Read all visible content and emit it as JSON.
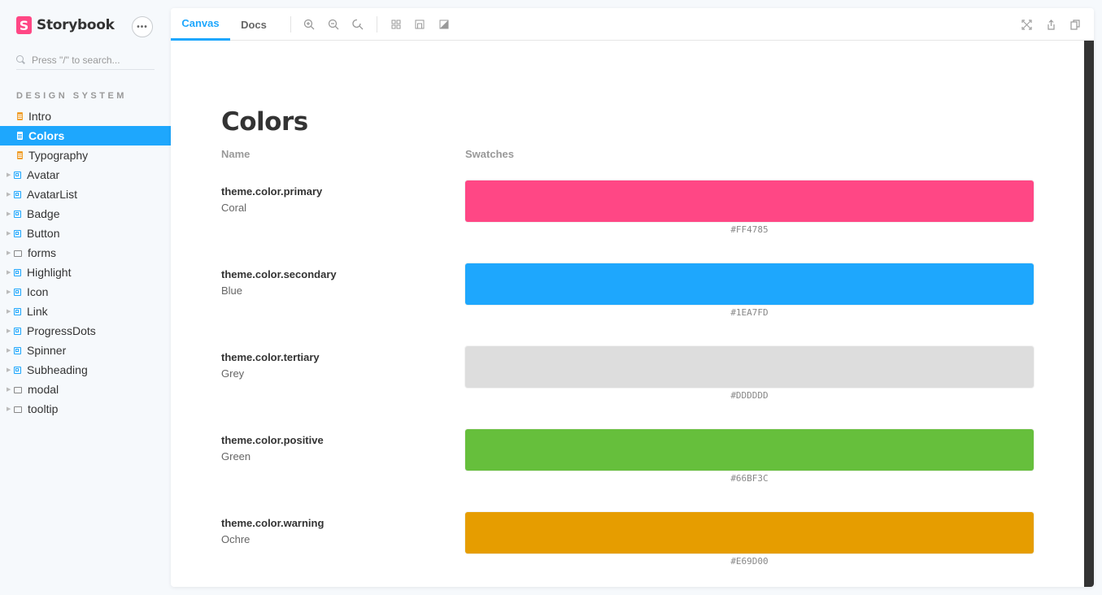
{
  "app": {
    "name": "Storybook",
    "logo_letter": "S"
  },
  "sidebar": {
    "menu_label": "•••",
    "search_placeholder": "Press \"/\" to search...",
    "section_title": "DESIGN SYSTEM",
    "items": [
      {
        "label": "Intro",
        "type": "doc",
        "expandable": false
      },
      {
        "label": "Colors",
        "type": "doc",
        "expandable": false,
        "active": true
      },
      {
        "label": "Typography",
        "type": "doc",
        "expandable": false
      },
      {
        "label": "Avatar",
        "type": "component",
        "expandable": true
      },
      {
        "label": "AvatarList",
        "type": "component",
        "expandable": true
      },
      {
        "label": "Badge",
        "type": "component",
        "expandable": true
      },
      {
        "label": "Button",
        "type": "component",
        "expandable": true
      },
      {
        "label": "forms",
        "type": "folder",
        "expandable": true
      },
      {
        "label": "Highlight",
        "type": "component",
        "expandable": true
      },
      {
        "label": "Icon",
        "type": "component",
        "expandable": true
      },
      {
        "label": "Link",
        "type": "component",
        "expandable": true
      },
      {
        "label": "ProgressDots",
        "type": "component",
        "expandable": true
      },
      {
        "label": "Spinner",
        "type": "component",
        "expandable": true
      },
      {
        "label": "Subheading",
        "type": "component",
        "expandable": true
      },
      {
        "label": "modal",
        "type": "folder",
        "expandable": true
      },
      {
        "label": "tooltip",
        "type": "folder",
        "expandable": true
      }
    ]
  },
  "toolbar": {
    "tabs": [
      {
        "label": "Canvas",
        "active": true
      },
      {
        "label": "Docs",
        "active": false
      }
    ],
    "tools": [
      "zoom-in-icon",
      "zoom-out-icon",
      "zoom-reset-icon",
      "grid-icon",
      "outline-icon",
      "contrast-icon"
    ],
    "right_tools": [
      "fullscreen-icon",
      "share-icon",
      "copy-link-icon"
    ]
  },
  "page": {
    "title": "Colors",
    "col_name": "Name",
    "col_swatches": "Swatches",
    "rows": [
      {
        "name": "theme.color.primary",
        "desc": "Coral",
        "hex": "#FF4785",
        "color": "#ff4785"
      },
      {
        "name": "theme.color.secondary",
        "desc": "Blue",
        "hex": "#1EA7FD",
        "color": "#1ea7fd"
      },
      {
        "name": "theme.color.tertiary",
        "desc": "Grey",
        "hex": "#DDDDDD",
        "color": "#dddddd"
      },
      {
        "name": "theme.color.positive",
        "desc": "Green",
        "hex": "#66BF3C",
        "color": "#66bf3c"
      },
      {
        "name": "theme.color.warning",
        "desc": "Ochre",
        "hex": "#E69D00",
        "color": "#e69d00"
      }
    ]
  },
  "colors": {
    "accent": "#1ea7fd",
    "brand": "#ff4785"
  }
}
